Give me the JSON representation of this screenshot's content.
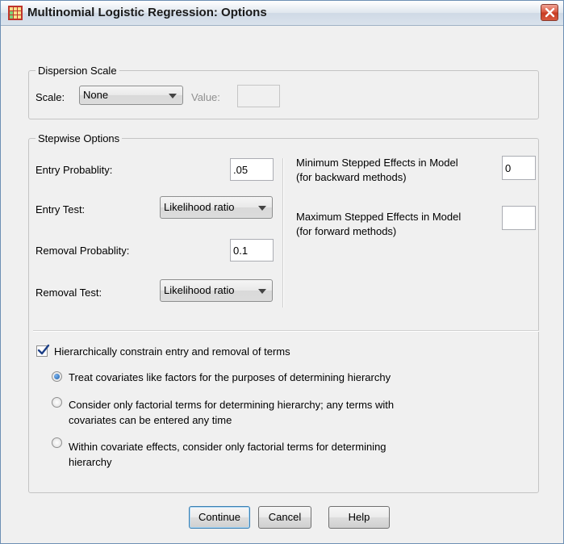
{
  "window": {
    "title": "Multinomial Logistic Regression: Options"
  },
  "dispersion": {
    "group_title": "Dispersion Scale",
    "scale_label": "Scale:",
    "scale_value": "None",
    "value_label": "Value:",
    "value_input": ""
  },
  "stepwise": {
    "group_title": "Stepwise Options",
    "entry_probability_label": "Entry Probablity:",
    "entry_probability_value": ".05",
    "entry_test_label": "Entry Test:",
    "entry_test_value": "Likelihood ratio",
    "removal_probability_label": "Removal Probablity:",
    "removal_probability_value": "0.1",
    "removal_test_label": "Removal Test:",
    "removal_test_value": "Likelihood ratio",
    "min_effects_label_1": "Minimum Stepped Effects in Model",
    "min_effects_label_2": "(for backward methods)",
    "min_effects_value": "0",
    "max_effects_label_1": "Maximum Stepped Effects in Model",
    "max_effects_label_2": "(for forward methods)",
    "max_effects_value": "",
    "hierarchy_checkbox_label": "Hierarchically constrain entry and removal of terms",
    "hierarchy_checked": true,
    "radio_options": [
      {
        "line1": "Treat covariates like factors for the purposes of determining hierarchy",
        "line2": "",
        "selected": true
      },
      {
        "line1": "Consider only factorial terms for determining hierarchy; any terms with",
        "line2": "covariates can be entered any time",
        "selected": false
      },
      {
        "line1": "Within covariate effects, consider only factorial terms for determining",
        "line2": "hierarchy",
        "selected": false
      }
    ]
  },
  "buttons": {
    "continue": "Continue",
    "cancel": "Cancel",
    "help": "Help"
  },
  "colors": {
    "title_bar": "#dfe6ee",
    "close_button": "#d8543c",
    "radio_selected": "#1d5ea8"
  },
  "icons": [
    "app-grid-icon",
    "close-icon",
    "dropdown-arrow-icon",
    "checkmark-icon"
  ]
}
